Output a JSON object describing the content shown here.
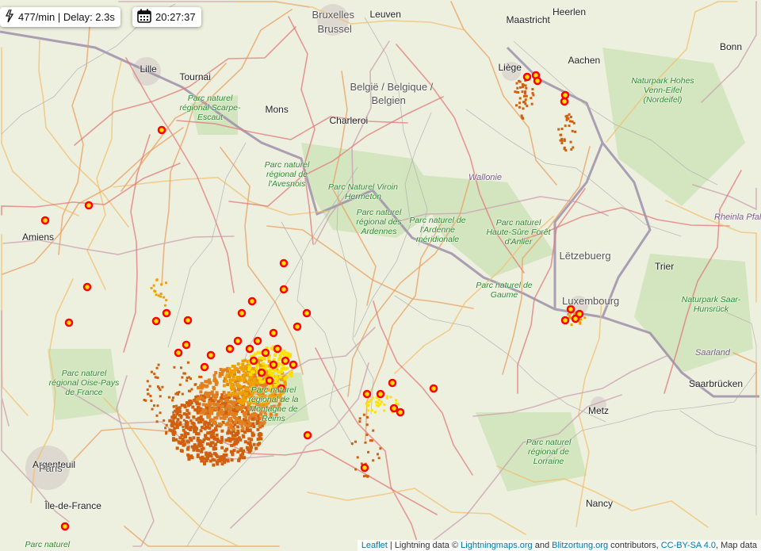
{
  "status": {
    "rate_delay": "477/min | Delay: 2.3s",
    "time": "20:27:37"
  },
  "labels": [
    "Bruxelles",
    "Brussel",
    "Leuven",
    "Maastricht",
    "Heerlen",
    "Aachen",
    "Bonn",
    "Liège",
    "Lille",
    "Tournai",
    "Mons",
    "Charleroi",
    "België / Belgique /",
    "Belgien",
    "Wallonie",
    "Lëtzebuerg",
    "Luxembourg",
    "Trier",
    "Saarland",
    "Saarbrücken",
    "Amiens",
    "Argenteuil",
    "Paris",
    "Île-de-France",
    "Metz",
    "Nancy",
    "Rheinla Pfal"
  ],
  "parks": [
    "Parc naturel régional Scarpe-Escaut",
    "Parc naturel régional de l'Avesnois",
    "Parc Naturel Viroin Hermeton",
    "Parc naturel régional des Ardennes",
    "Parc naturel de l'Ardenne méridionale",
    "Parc naturel Haute-Sûre Forêt d'Anlier",
    "Naturpark Hohes Venn-Eifel (Nordeifel)",
    "Parc naturel de Gaume",
    "Naturpark Saar-Hunsrück",
    "Parc naturel régional Oise-Pays de France",
    "Parc naturel régional de la Montagne de Reims",
    "Parc naturel régional de Lorraine",
    "Parc naturel"
  ],
  "attribution": {
    "leaflet": "Leaflet",
    "sep": " | Lightning data © ",
    "lightningmaps": "Lightningmaps.org",
    "and": " and ",
    "blitzortung": "Blitzortung.org",
    "contributors": " contributors, ",
    "license": "CC-BY-SA 4.0",
    "mapdata": ", Map data"
  },
  "colors": {
    "recent": "#ff0000",
    "yellow": "#ffe000",
    "orange": "#f0a000",
    "old": "#d06010"
  }
}
